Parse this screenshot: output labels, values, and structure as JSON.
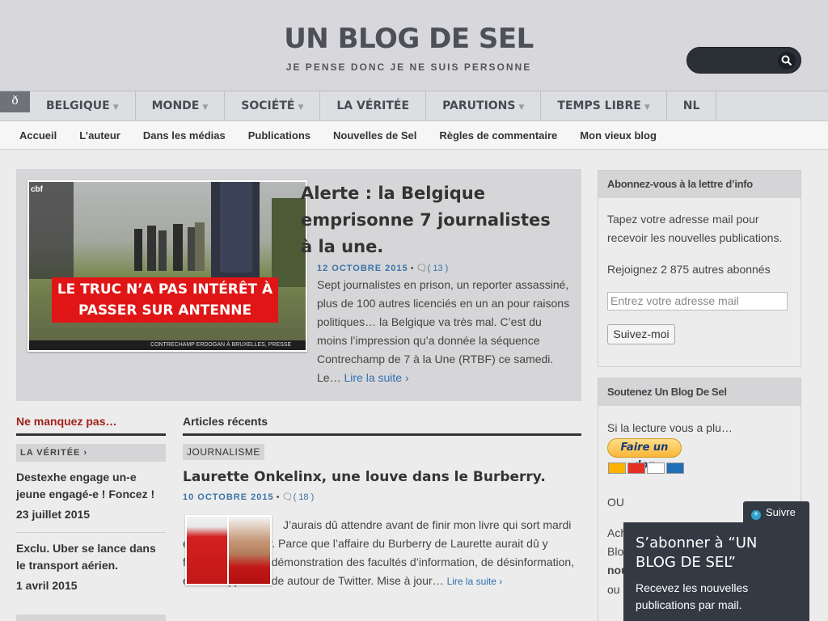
{
  "header": {
    "title": "UN BLOG DE SEL",
    "tagline": "JE PENSE DONC JE NE SUIS PERSONNE",
    "search_icon": "search-icon"
  },
  "main_nav": {
    "home_glyph": "ð",
    "items": [
      {
        "label": "BELGIQUE",
        "has_caret": true
      },
      {
        "label": "MONDE",
        "has_caret": true
      },
      {
        "label": "SOCIÉTÉ",
        "has_caret": true
      },
      {
        "label": "LA VÉRITÉE",
        "has_caret": false
      },
      {
        "label": "PARUTIONS",
        "has_caret": true
      },
      {
        "label": "TEMPS LIBRE",
        "has_caret": true
      },
      {
        "label": "NL",
        "has_caret": false
      }
    ]
  },
  "sub_nav": [
    "Accueil",
    "L’auteur",
    "Dans les médias",
    "Publications",
    "Nouvelles de Sel",
    "Règles de commentaire",
    "Mon vieux blog"
  ],
  "featured": {
    "image_caption": "LE TRUC N’A PAS INTÉRÊT À PASSER SUR ANTENNE",
    "image_logo": "cbf",
    "image_banner": "CONTRECHAMP  ERDOGAN À BRUXELLES, PRESSE MALM",
    "title": "Alerte : la Belgique emprisonne 7 journalistes à la une.",
    "date": "12 OCTOBRE 2015",
    "comments": "13",
    "excerpt": "Sept journalistes en prison, un reporter assassiné, plus de 100 autres licenciés en un an pour raisons politiques… la Belgique va très mal. C’est du moins l’impression qu’a donnée la séquence Contrechamp de 7 à la Une (RTBF) ce samedi. Le…",
    "read_more": "Lire la suite ›"
  },
  "ne_manquez": {
    "heading": "Ne manquez pas…",
    "category": "LA VÉRITÉE ›",
    "posts": [
      {
        "title": "Destexhe engage un-e jeune engagé-e ! Foncez !",
        "date": "23 juillet 2015"
      },
      {
        "title": "Exclu. Uber se lance dans le transport aérien.",
        "date": "1 avril 2015"
      }
    ]
  },
  "recent": {
    "heading": "Articles récents",
    "tag": "JOURNALISME",
    "title": "Laurette Onkelinx, une louve dans le Burberry.",
    "date": "10 OCTOBRE 2015",
    "comments": "18",
    "excerpt": "J’aurais dû attendre avant de finir mon livre qui sort mardi et parle de Twitter. Parce que l’affaire du Burberry de Laurette aurait dû y figurer. Une belle démonstration des facultés d’information, de désinformation, et de me(r)diatittude autour de Twitter. Mise à jour…",
    "read_more": "Lire la suite ›"
  },
  "widget_newsletter": {
    "heading": "Abonnez-vous à la lettre d’info",
    "text": "Tapez votre adresse mail pour recevoir les nouvelles publications.",
    "subscribers": "Rejoignez 2 875 autres abonnés",
    "email_placeholder": "Entrez votre adresse mail",
    "button": "Suivez-moi"
  },
  "widget_support": {
    "heading": "Soutenez Un Blog De Sel",
    "text": "Si la lecture vous a plu…",
    "donate": "Faire un don",
    "or": "OU",
    "partial_lines": [
      "Ach",
      "Blo",
      "nou",
      "ou"
    ]
  },
  "follow": {
    "tab": "Suivre",
    "title": "S’abonner à “UN BLOG DE SEL”",
    "text": "Recevez les nouvelles publications par mail."
  }
}
